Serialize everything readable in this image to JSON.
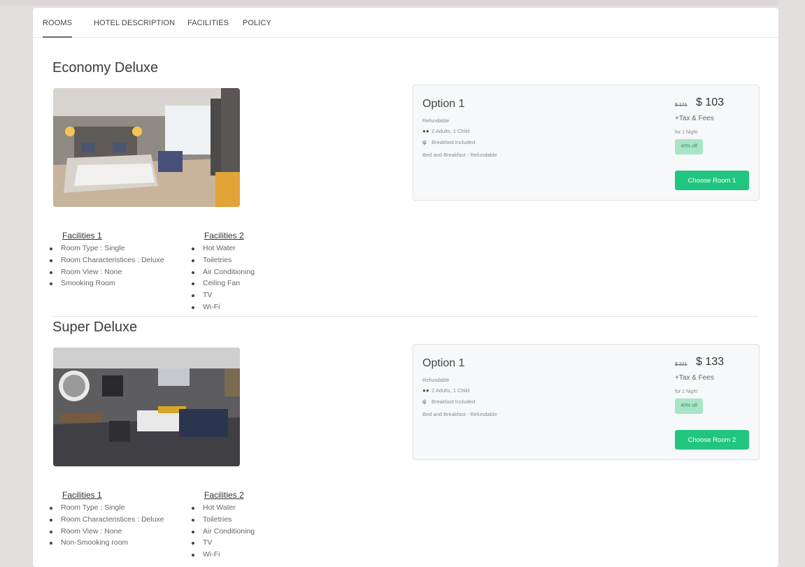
{
  "tabs": [
    {
      "label": "ROOMS",
      "active": true
    },
    {
      "label": "HOTEL DESCRIPTION",
      "active": false
    },
    {
      "label": "FACILITIES",
      "active": false
    },
    {
      "label": "POLICY",
      "active": false
    }
  ],
  "rooms": [
    {
      "title": "Economy Deluxe",
      "facilities1": {
        "heading": "Facilities 1",
        "items": [
          "Room Type : Single",
          "Room Characteristices : Deluxe",
          "Room View : None",
          "Smooking Room"
        ]
      },
      "facilities2": {
        "heading": "Facilities 2",
        "items": [
          "Hot Water",
          "Toiletries",
          "Air Conditioning",
          "Ceiling Fan",
          "TV",
          "Wi-Fi"
        ]
      },
      "option": {
        "title": "Option 1",
        "refundable": "Refundable",
        "guests": "2 Adults, 1 Child",
        "breakfast": "Breakfast Included",
        "plan": "Bed and Breakfast - Refundable",
        "old_price": "$ 171",
        "price": "$ 103",
        "tax": "+Tax & Fees",
        "nights": "for 1 Night",
        "discount": "40% off",
        "button": "Choose Room 1"
      }
    },
    {
      "title": "Super Deluxe",
      "facilities1": {
        "heading": "Facilities 1",
        "items": [
          "Room Type : Single",
          "Room Characteristices : Deluxe",
          "Room View : None",
          "Non-Smooking room"
        ]
      },
      "facilities2": {
        "heading": "Facilities 2",
        "items": [
          "Hot Water",
          "Toiletries",
          "Air Conditioning",
          "TV",
          "Wi-Fi"
        ]
      },
      "option": {
        "title": "Option 1",
        "refundable": "Refundable",
        "guests": "2 Adults, 1 Child",
        "breakfast": "Breakfast Included",
        "plan": "Bed and Breakfast - Refundable",
        "old_price": "$ 221",
        "price": "$ 133",
        "tax": "+Tax & Fees",
        "nights": "for 1 Night",
        "discount": "40% off",
        "button": "Choose Room 2"
      }
    }
  ],
  "icons": {
    "guests": "users-icon",
    "breakfast": "cutlery-icon"
  },
  "colors": {
    "accent": "#22c57f",
    "discount_bg": "#a8e5c6",
    "card_bg": "#f7f8fa",
    "page_bg": "#e3dfdf"
  }
}
